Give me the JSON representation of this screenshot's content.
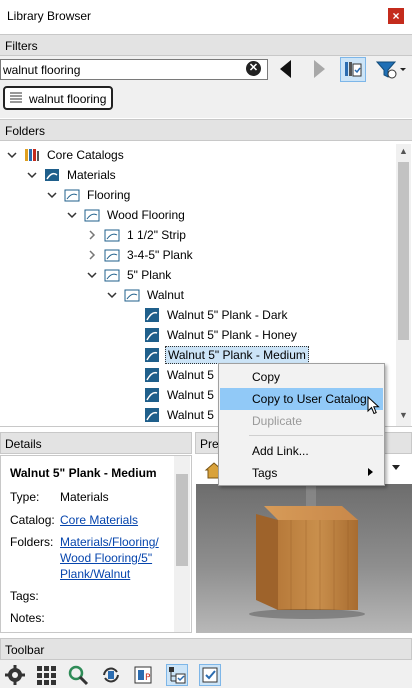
{
  "window": {
    "title": "Library Browser",
    "close_label": "×"
  },
  "filters": {
    "header": "Filters",
    "search_value": "walnut flooring",
    "active_tag": "walnut flooring"
  },
  "folders": {
    "header": "Folders",
    "tree": [
      {
        "label": "Core Catalogs",
        "icon": "catalog-books-icon",
        "expanded": true
      },
      {
        "label": "Materials",
        "icon": "materials-folder-icon",
        "expanded": true
      },
      {
        "label": "Flooring",
        "icon": "folder-outline-icon",
        "expanded": true
      },
      {
        "label": "Wood Flooring",
        "icon": "folder-outline-icon",
        "expanded": true
      },
      {
        "label": "1 1/2\" Strip",
        "icon": "folder-outline-icon",
        "expanded": false
      },
      {
        "label": "3-4-5\" Plank",
        "icon": "folder-outline-icon",
        "expanded": false
      },
      {
        "label": "5\" Plank",
        "icon": "folder-outline-icon",
        "expanded": true
      },
      {
        "label": "Walnut",
        "icon": "folder-outline-icon",
        "expanded": true
      },
      {
        "label": "Walnut 5\" Plank - Dark",
        "icon": "material-swatch-icon"
      },
      {
        "label": "Walnut 5\" Plank - Honey",
        "icon": "material-swatch-icon"
      },
      {
        "label": "Walnut 5\" Plank - Medium",
        "icon": "material-swatch-icon",
        "selected": true
      },
      {
        "label": "Walnut 5",
        "icon": "material-swatch-icon"
      },
      {
        "label": "Walnut 5",
        "icon": "material-swatch-icon"
      },
      {
        "label": "Walnut 5",
        "icon": "material-swatch-icon"
      }
    ]
  },
  "context_menu": {
    "items": [
      {
        "label": "Copy",
        "state": "normal"
      },
      {
        "label": "Copy to User Catalog",
        "state": "hover"
      },
      {
        "label": "Duplicate",
        "state": "disabled"
      },
      {
        "label": "Add Link...",
        "state": "normal"
      },
      {
        "label": "Tags",
        "state": "submenu"
      }
    ]
  },
  "details": {
    "header": "Details",
    "title": "Walnut 5\" Plank - Medium",
    "type_label": "Type:",
    "type_value": "Materials",
    "catalog_label": "Catalog:",
    "catalog_value": "Core Materials",
    "folders_label": "Folders:",
    "folders_value_line1": "Materials/Flooring/",
    "folders_value_line2": "Wood Flooring/5\"",
    "folders_value_line3": "Plank/Walnut",
    "tags_label": "Tags:",
    "notes_label": "Notes:"
  },
  "preview": {
    "header": "Pre"
  },
  "toolbar": {
    "header": "Toolbar"
  },
  "colors": {
    "accent": "#cce4f7",
    "close": "#c42b1c",
    "menu_hover": "#91c9f7",
    "link": "#0645ad"
  }
}
